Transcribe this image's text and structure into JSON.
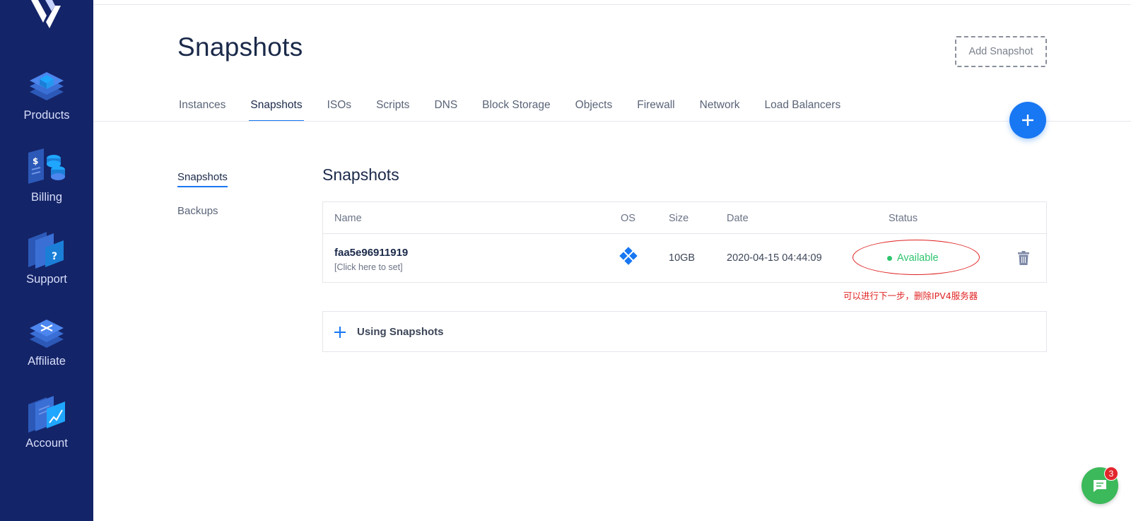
{
  "sidebar": {
    "items": [
      {
        "label": "Products"
      },
      {
        "label": "Billing"
      },
      {
        "label": "Support"
      },
      {
        "label": "Affiliate"
      },
      {
        "label": "Account"
      }
    ]
  },
  "header": {
    "title": "Snapshots",
    "add_button_label": "Add Snapshot"
  },
  "tabs": [
    {
      "label": "Instances"
    },
    {
      "label": "Snapshots",
      "active": true
    },
    {
      "label": "ISOs"
    },
    {
      "label": "Scripts"
    },
    {
      "label": "DNS"
    },
    {
      "label": "Block Storage"
    },
    {
      "label": "Objects"
    },
    {
      "label": "Firewall"
    },
    {
      "label": "Network"
    },
    {
      "label": "Load Balancers"
    }
  ],
  "subnav": {
    "items": [
      {
        "label": "Snapshots",
        "active": true
      },
      {
        "label": "Backups"
      }
    ]
  },
  "section": {
    "title": "Snapshots"
  },
  "table": {
    "columns": [
      "Name",
      "OS",
      "Size",
      "Date",
      "Status"
    ],
    "rows": [
      {
        "name": "faa5e96911919",
        "description": "[Click here to set]",
        "os_icon": "windows-icon",
        "size": "10GB",
        "date": "2020-04-15 04:44:09",
        "status": "Available"
      }
    ]
  },
  "annotation": {
    "text": "可以进行下一步，删除IPV4服务器"
  },
  "using_snapshots": {
    "label": "Using Snapshots"
  },
  "chat": {
    "badge_count": "3"
  },
  "colors": {
    "sidebar_bg": "#142468",
    "accent": "#1877f2",
    "status_available": "#2ec46d",
    "annotation_red": "#e02424",
    "chat_green": "#3cb95a"
  }
}
